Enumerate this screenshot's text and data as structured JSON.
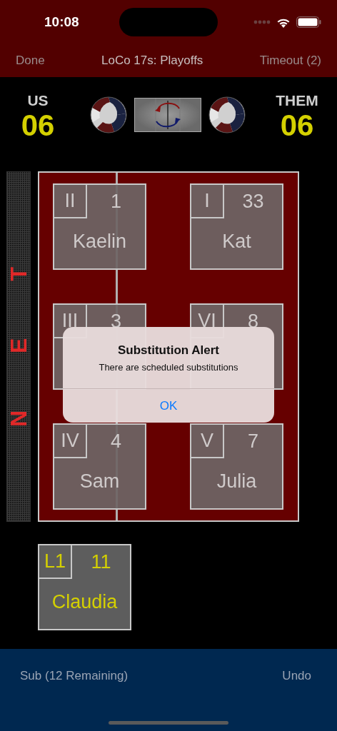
{
  "status_bar": {
    "time": "10:08"
  },
  "nav": {
    "left": "Done",
    "title": "LoCo 17s: Playoffs",
    "right": "Timeout (2)"
  },
  "score": {
    "home_label": "US",
    "home_score": "06",
    "away_label": "THEM",
    "away_score": "06"
  },
  "net_label": "NET",
  "court": {
    "players": [
      {
        "position": "II",
        "number": "1",
        "name": "Kaelin"
      },
      {
        "position": "I",
        "number": "33",
        "name": "Kat"
      },
      {
        "position": "III",
        "number": "3"
      },
      {
        "position": "VI",
        "number": "8"
      },
      {
        "position": "IV",
        "number": "4",
        "name": "Sam"
      },
      {
        "position": "V",
        "number": "7",
        "name": "Julia"
      }
    ]
  },
  "libero": {
    "position": "L1",
    "number": "11",
    "name": "Claudia"
  },
  "alert": {
    "title": "Substitution Alert",
    "message": "There are scheduled substitutions",
    "button": "OK"
  },
  "toolbar": {
    "left": "Sub (12 Remaining)",
    "right": "Undo"
  }
}
